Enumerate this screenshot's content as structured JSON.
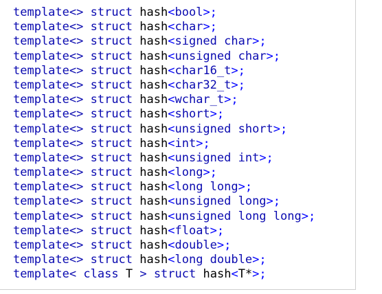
{
  "colors": {
    "keyword": "#0a0ab0",
    "identifier": "#000000",
    "punctuation": "#0000ff",
    "background": "#ffffff"
  },
  "code": {
    "lines": [
      {
        "template": "template<>",
        "struct": "struct",
        "name": "hash",
        "open": "<",
        "type": "bool",
        "close": ">;"
      },
      {
        "template": "template<>",
        "struct": "struct",
        "name": "hash",
        "open": "<",
        "type": "char",
        "close": ">;"
      },
      {
        "template": "template<>",
        "struct": "struct",
        "name": "hash",
        "open": "<",
        "type": "signed char",
        "close": ">;"
      },
      {
        "template": "template<>",
        "struct": "struct",
        "name": "hash",
        "open": "<",
        "type": "unsigned char",
        "close": ">;"
      },
      {
        "template": "template<>",
        "struct": "struct",
        "name": "hash",
        "open": "<",
        "type": "char16_t",
        "close": ">;"
      },
      {
        "template": "template<>",
        "struct": "struct",
        "name": "hash",
        "open": "<",
        "type": "char32_t",
        "close": ">;"
      },
      {
        "template": "template<>",
        "struct": "struct",
        "name": "hash",
        "open": "<",
        "type": "wchar_t",
        "close": ">;"
      },
      {
        "template": "template<>",
        "struct": "struct",
        "name": "hash",
        "open": "<",
        "type": "short",
        "close": ">;"
      },
      {
        "template": "template<>",
        "struct": "struct",
        "name": "hash",
        "open": "<",
        "type": "unsigned short",
        "close": ">;"
      },
      {
        "template": "template<>",
        "struct": "struct",
        "name": "hash",
        "open": "<",
        "type": "int",
        "close": ">;"
      },
      {
        "template": "template<>",
        "struct": "struct",
        "name": "hash",
        "open": "<",
        "type": "unsigned int",
        "close": ">;"
      },
      {
        "template": "template<>",
        "struct": "struct",
        "name": "hash",
        "open": "<",
        "type": "long",
        "close": ">;"
      },
      {
        "template": "template<>",
        "struct": "struct",
        "name": "hash",
        "open": "<",
        "type": "long long",
        "close": ">;"
      },
      {
        "template": "template<>",
        "struct": "struct",
        "name": "hash",
        "open": "<",
        "type": "unsigned long",
        "close": ">;"
      },
      {
        "template": "template<>",
        "struct": "struct",
        "name": "hash",
        "open": "<",
        "type": "unsigned long long",
        "close": ">;"
      },
      {
        "template": "template<>",
        "struct": "struct",
        "name": "hash",
        "open": "<",
        "type": "float",
        "close": ">;"
      },
      {
        "template": "template<>",
        "struct": "struct",
        "name": "hash",
        "open": "<",
        "type": "double",
        "close": ">;"
      },
      {
        "template": "template<>",
        "struct": "struct",
        "name": "hash",
        "open": "<",
        "type": "long double",
        "close": ">;"
      }
    ],
    "last_line": {
      "template": "template<",
      "class_kw": "class",
      "param": "T",
      "gt": ">",
      "struct": "struct",
      "name": "hash",
      "open": "<",
      "type": "T*",
      "close": ">;"
    }
  }
}
